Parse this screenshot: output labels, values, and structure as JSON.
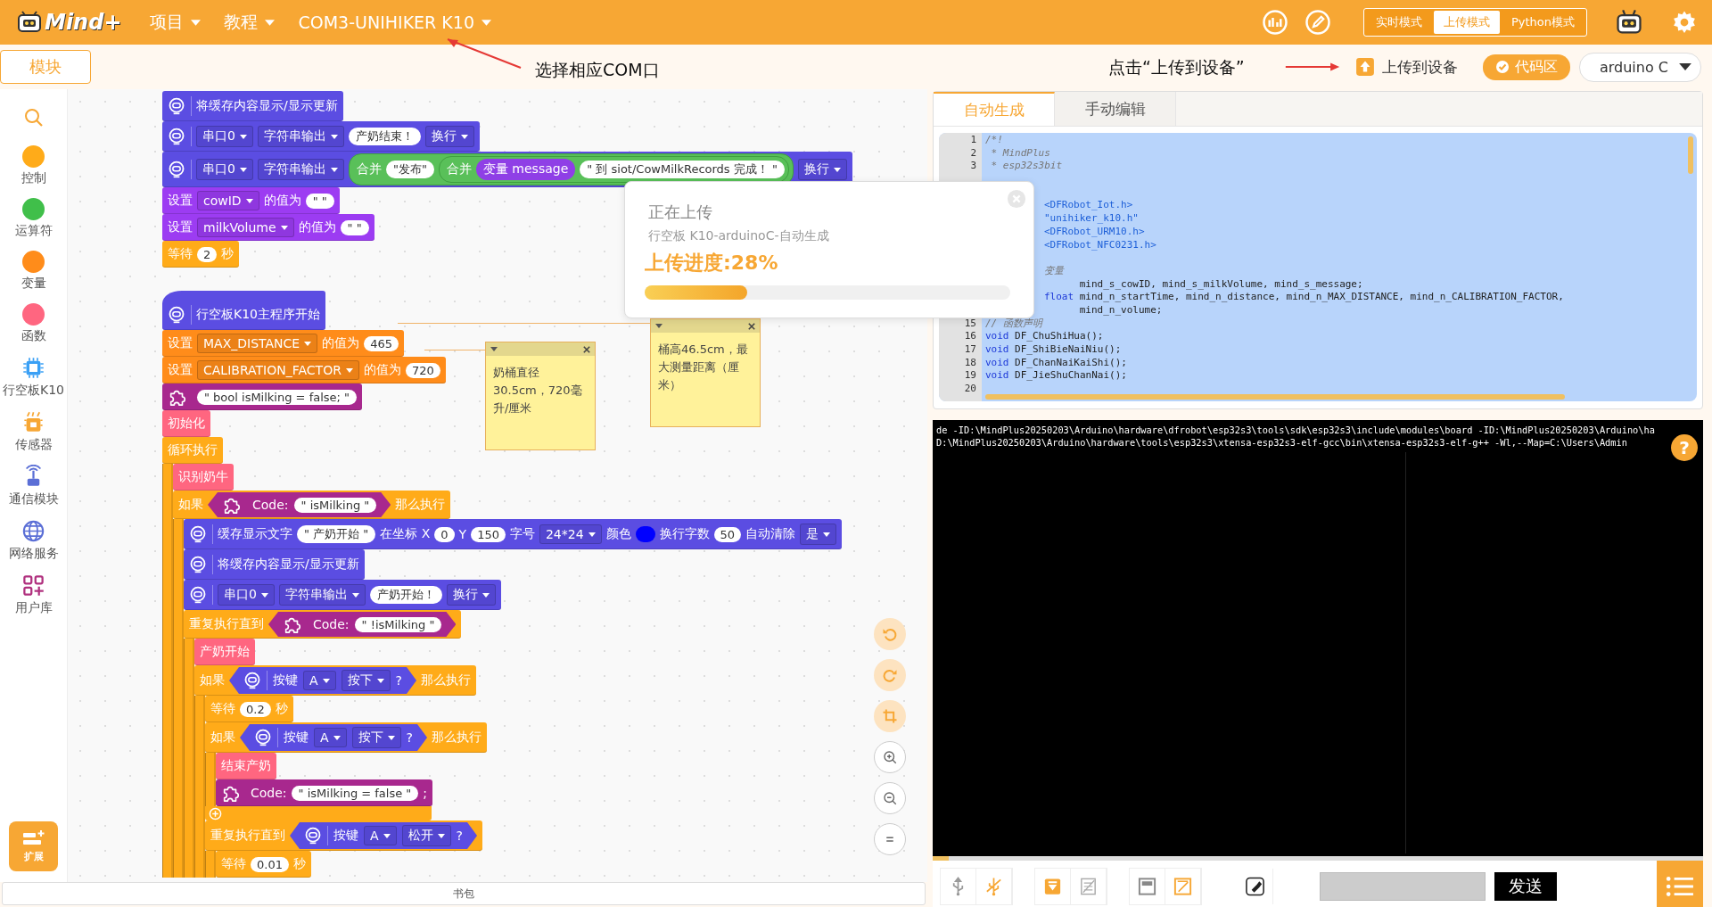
{
  "topbar": {
    "logo": "Mind+",
    "menus": [
      {
        "label": "项目"
      },
      {
        "label": "教程"
      },
      {
        "label": "COM3-UNIHIKER K10"
      }
    ],
    "modes": [
      {
        "label": "实时模式",
        "selected": false
      },
      {
        "label": "上传模式",
        "selected": true
      },
      {
        "label": "Python模式",
        "selected": false
      }
    ]
  },
  "toolbar": {
    "blocks_tab": "模块",
    "upload_button": "上传到设备",
    "code_toggle": {
      "label": "代码区",
      "on": true
    },
    "language": "arduino C"
  },
  "annotations": [
    {
      "text": "选择相应COM口"
    },
    {
      "text": "点击“上传到设备”"
    }
  ],
  "sidebar": {
    "categories": [
      {
        "label": "控制",
        "kind": "dot",
        "color": "#ffab19"
      },
      {
        "label": "运算符",
        "kind": "dot",
        "color": "#40bf4a"
      },
      {
        "label": "变量",
        "kind": "dot",
        "color": "#ff8c1a"
      },
      {
        "label": "函数",
        "kind": "dot",
        "color": "#ff6680"
      },
      {
        "label": "行空板K10",
        "kind": "board"
      },
      {
        "label": "传感器",
        "kind": "sensor"
      },
      {
        "label": "通信模块",
        "kind": "radio"
      },
      {
        "label": "网络服务",
        "kind": "globe"
      },
      {
        "label": "用户库",
        "kind": "library"
      }
    ],
    "extension_button": "扩展"
  },
  "scripts": [
    {
      "blocks": [
        {
          "kind": "board",
          "parts": [
            {
              "kind": "board_icon"
            },
            {
              "kind": "label",
              "text": "将缓存内容显示/显示更新"
            }
          ]
        },
        {
          "kind": "board",
          "parts": [
            {
              "kind": "board_icon"
            },
            {
              "kind": "menu",
              "text": "串口0"
            },
            {
              "kind": "menu",
              "text": "字符串输出"
            },
            {
              "kind": "string",
              "text": "产奶结束！"
            },
            {
              "kind": "menu",
              "text": "换行"
            }
          ]
        },
        {
          "kind": "board",
          "parts": [
            {
              "kind": "board_icon"
            },
            {
              "kind": "menu",
              "text": "串口0"
            },
            {
              "kind": "menu",
              "text": "字符串输出"
            },
            {
              "kind": "join",
              "parts": [
                {
                  "kind": "label",
                  "text": "合并"
                },
                {
                  "kind": "string",
                  "text": "\"发布\""
                },
                {
                  "kind": "join",
                  "parts": [
                    {
                      "kind": "label",
                      "text": "合并"
                    },
                    {
                      "kind": "variable",
                      "text": "变量 message"
                    },
                    {
                      "kind": "string",
                      "text": "\" 到 siot/CowMilkRecords 完成！ \""
                    }
                  ]
                }
              ]
            },
            {
              "kind": "menu",
              "text": "换行"
            }
          ]
        },
        {
          "kind": "data",
          "parts": [
            {
              "kind": "label",
              "text": "设置"
            },
            {
              "kind": "menu",
              "text": "cowID"
            },
            {
              "kind": "label",
              "text": "的值为"
            },
            {
              "kind": "string",
              "text": "\" \""
            }
          ]
        },
        {
          "kind": "data",
          "parts": [
            {
              "kind": "label",
              "text": "设置"
            },
            {
              "kind": "menu",
              "text": "milkVolume"
            },
            {
              "kind": "label",
              "text": "的值为"
            },
            {
              "kind": "string",
              "text": "\" \""
            }
          ]
        },
        {
          "kind": "control",
          "parts": [
            {
              "kind": "label",
              "text": "等待"
            },
            {
              "kind": "number",
              "text": "2"
            },
            {
              "kind": "label",
              "text": "秒"
            }
          ]
        }
      ]
    },
    {
      "blocks": [
        {
          "kind": "event",
          "parts": [
            {
              "kind": "board_icon"
            },
            {
              "kind": "label",
              "text": "行空板K10主程序开始"
            }
          ]
        },
        {
          "kind": "variable",
          "parts": [
            {
              "kind": "label",
              "text": "设置"
            },
            {
              "kind": "menu",
              "text": "MAX_DISTANCE"
            },
            {
              "kind": "label",
              "text": "的值为"
            },
            {
              "kind": "number",
              "text": "465"
            }
          ]
        },
        {
          "kind": "variable",
          "parts": [
            {
              "kind": "label",
              "text": "设置"
            },
            {
              "kind": "menu",
              "text": "CALIBRATION_FACTOR"
            },
            {
              "kind": "label",
              "text": "的值为"
            },
            {
              "kind": "number",
              "text": "720"
            }
          ]
        },
        {
          "kind": "code",
          "parts": [
            {
              "kind": "code_icon"
            },
            {
              "kind": "string",
              "text": "\" bool isMilking = false; \""
            }
          ]
        },
        {
          "kind": "function",
          "parts": [
            {
              "kind": "label",
              "text": "初始化"
            }
          ]
        },
        {
          "kind": "control",
          "parts": [
            {
              "kind": "label",
              "text": "循环执行"
            }
          ],
          "children": [
            {
              "kind": "function",
              "parts": [
                {
                  "kind": "label",
                  "text": "识别奶牛"
                }
              ]
            },
            {
              "kind": "control",
              "parts": [
                {
                  "kind": "label",
                  "text": "如果"
                },
                {
                  "kind": "code_condition",
                  "parts": [
                    {
                      "kind": "code_icon"
                    },
                    {
                      "kind": "label",
                      "text": "Code:"
                    },
                    {
                      "kind": "string",
                      "text": "\" isMilking \""
                    }
                  ]
                },
                {
                  "kind": "label",
                  "text": "那么执行"
                }
              ],
              "children": [
                {
                  "kind": "board",
                  "parts": [
                    {
                      "kind": "board_icon"
                    },
                    {
                      "kind": "label",
                      "text": "缓存显示文字"
                    },
                    {
                      "kind": "string",
                      "text": "\" 产奶开始 \""
                    },
                    {
                      "kind": "label",
                      "text": "在坐标 X"
                    },
                    {
                      "kind": "number",
                      "text": "0"
                    },
                    {
                      "kind": "label",
                      "text": "Y"
                    },
                    {
                      "kind": "number",
                      "text": "150"
                    },
                    {
                      "kind": "label",
                      "text": "字号"
                    },
                    {
                      "kind": "menu",
                      "text": "24*24"
                    },
                    {
                      "kind": "label",
                      "text": "颜色"
                    },
                    {
                      "kind": "color",
                      "color": "#0000ff"
                    },
                    {
                      "kind": "label",
                      "text": "换行字数"
                    },
                    {
                      "kind": "number",
                      "text": "50"
                    },
                    {
                      "kind": "label",
                      "text": "自动清除"
                    },
                    {
                      "kind": "menu",
                      "text": "是"
                    }
                  ]
                },
                {
                  "kind": "board",
                  "parts": [
                    {
                      "kind": "board_icon"
                    },
                    {
                      "kind": "label",
                      "text": "将缓存内容显示/显示更新"
                    }
                  ]
                },
                {
                  "kind": "board",
                  "parts": [
                    {
                      "kind": "board_icon"
                    },
                    {
                      "kind": "menu",
                      "text": "串口0"
                    },
                    {
                      "kind": "menu",
                      "text": "字符串输出"
                    },
                    {
                      "kind": "string",
                      "text": "产奶开始！"
                    },
                    {
                      "kind": "menu",
                      "text": "换行"
                    }
                  ]
                },
                {
                  "kind": "control",
                  "parts": [
                    {
                      "kind": "label",
                      "text": "重复执行直到"
                    },
                    {
                      "kind": "code_condition",
                      "parts": [
                        {
                          "kind": "code_icon"
                        },
                        {
                          "kind": "label",
                          "text": "Code:"
                        },
                        {
                          "kind": "string",
                          "text": "\" !isMilking \""
                        }
                      ]
                    }
                  ],
                  "children": [
                    {
                      "kind": "function",
                      "parts": [
                        {
                          "kind": "label",
                          "text": "产奶开始"
                        }
                      ]
                    },
                    {
                      "kind": "control",
                      "parts": [
                        {
                          "kind": "label",
                          "text": "如果"
                        },
                        {
                          "kind": "board_condition",
                          "parts": [
                            {
                              "kind": "board_icon"
                            },
                            {
                              "kind": "label",
                              "text": "按键"
                            },
                            {
                              "kind": "menu",
                              "text": "A"
                            },
                            {
                              "kind": "menu",
                              "text": "按下"
                            },
                            {
                              "kind": "label",
                              "text": "?"
                            }
                          ]
                        },
                        {
                          "kind": "label",
                          "text": "那么执行"
                        }
                      ],
                      "children": [
                        {
                          "kind": "control",
                          "parts": [
                            {
                              "kind": "label",
                              "text": "等待"
                            },
                            {
                              "kind": "number",
                              "text": "0.2"
                            },
                            {
                              "kind": "label",
                              "text": "秒"
                            }
                          ]
                        },
                        {
                          "kind": "control",
                          "closed": true,
                          "add_button": true,
                          "parts": [
                            {
                              "kind": "label",
                              "text": "如果"
                            },
                            {
                              "kind": "board_condition",
                              "parts": [
                                {
                                  "kind": "board_icon"
                                },
                                {
                                  "kind": "label",
                                  "text": "按键"
                                },
                                {
                                  "kind": "menu",
                                  "text": "A"
                                },
                                {
                                  "kind": "menu",
                                  "text": "按下"
                                },
                                {
                                  "kind": "label",
                                  "text": "?"
                                }
                              ]
                            },
                            {
                              "kind": "label",
                              "text": "那么执行"
                            }
                          ],
                          "children": [
                            {
                              "kind": "function",
                              "parts": [
                                {
                                  "kind": "label",
                                  "text": "结束产奶"
                                }
                              ]
                            },
                            {
                              "kind": "code",
                              "parts": [
                                {
                                  "kind": "code_icon"
                                },
                                {
                                  "kind": "label",
                                  "text": "Code:"
                                },
                                {
                                  "kind": "string",
                                  "text": "\" isMilking = false \""
                                },
                                {
                                  "kind": "label",
                                  "text": ";"
                                }
                              ]
                            }
                          ]
                        },
                        {
                          "kind": "control",
                          "parts": [
                            {
                              "kind": "label",
                              "text": "重复执行直到"
                            },
                            {
                              "kind": "board_condition",
                              "parts": [
                                {
                                  "kind": "board_icon"
                                },
                                {
                                  "kind": "label",
                                  "text": "按键"
                                },
                                {
                                  "kind": "menu",
                                  "text": "A"
                                },
                                {
                                  "kind": "menu",
                                  "text": "松开"
                                },
                                {
                                  "kind": "label",
                                  "text": "?"
                                }
                              ]
                            }
                          ],
                          "children": [
                            {
                              "kind": "control",
                              "parts": [
                                {
                                  "kind": "label",
                                  "text": "等待"
                                },
                                {
                                  "kind": "number",
                                  "text": "0.01"
                                },
                                {
                                  "kind": "label",
                                  "text": "秒"
                                }
                              ]
                            }
                          ]
                        }
                      ]
                    }
                  ]
                }
              ]
            }
          ]
        }
      ]
    }
  ],
  "notes": [
    {
      "text": "奶桶直径30.5cm，720毫升/厘米"
    },
    {
      "text": "桶高46.5cm，最大测量距离（厘米）"
    }
  ],
  "upload_dialog": {
    "title": "正在上传",
    "subtitle": "行空板 K10-arduinoC-自动生成",
    "progress_text": "上传进度:28%",
    "level": 0.28
  },
  "backpack": "书包",
  "code_panel": {
    "tabs": [
      {
        "label": "自动生成",
        "selected": true
      },
      {
        "label": "手动编辑",
        "selected": false
      }
    ],
    "lines": [
      {
        "number": "1",
        "tokens": [
          {
            "kind": "comment",
            "text": "/*!"
          }
        ]
      },
      {
        "number": "2",
        "tokens": [
          {
            "kind": "comment",
            "text": " * MindPlus"
          }
        ]
      },
      {
        "number": "3",
        "tokens": [
          {
            "kind": "comment",
            "text": " * esp32s3bit"
          }
        ]
      },
      {
        "covered": true
      },
      {
        "covered": true
      },
      {
        "covered": true,
        "tokens": [
          {
            "kind": "include",
            "text": "<DFRobot_Iot.h>"
          }
        ]
      },
      {
        "covered": true,
        "tokens": [
          {
            "kind": "include",
            "text": "\"unihiker_k10.h\""
          }
        ]
      },
      {
        "covered": true,
        "tokens": [
          {
            "kind": "include",
            "text": "<DFRobot_URM10.h>"
          }
        ]
      },
      {
        "covered": true,
        "tokens": [
          {
            "kind": "include",
            "text": "<DFRobot_NFC0231.h>"
          }
        ]
      },
      {
        "covered": true
      },
      {
        "covered": true,
        "tokens": [
          {
            "kind": "comment",
            "text": "变量"
          }
        ]
      },
      {
        "covered": true,
        "tokens": [
          {
            "kind": "plain",
            "text": "      mind_s_cowID, mind_s_milkVolume, mind_s_message;"
          }
        ]
      },
      {
        "covered": true,
        "tokens": [
          {
            "kind": "keyword",
            "text": "float"
          },
          {
            "kind": "plain",
            "text": " mind_n_startTime, mind_n_distance, mind_n_MAX_DISTANCE, mind_n_CALIBRATION_FACTOR,"
          }
        ]
      },
      {
        "covered": true,
        "tokens": [
          {
            "kind": "plain",
            "text": "      mind_n_volume;"
          }
        ]
      },
      {
        "number": "15",
        "tokens": [
          {
            "kind": "comment",
            "text": "// 函数声明"
          }
        ]
      },
      {
        "number": "16",
        "tokens": [
          {
            "kind": "keyword",
            "text": "void"
          },
          {
            "kind": "plain",
            "text": " DF_ChuShiHua();"
          }
        ]
      },
      {
        "number": "17",
        "tokens": [
          {
            "kind": "keyword",
            "text": "void"
          },
          {
            "kind": "plain",
            "text": " DF_ShiBieNaiNiu();"
          }
        ]
      },
      {
        "number": "18",
        "tokens": [
          {
            "kind": "keyword",
            "text": "void"
          },
          {
            "kind": "plain",
            "text": " DF_ChanNaiKaiShi();"
          }
        ]
      },
      {
        "number": "19",
        "tokens": [
          {
            "kind": "keyword",
            "text": "void"
          },
          {
            "kind": "plain",
            "text": " DF_JieShuChanNai();"
          }
        ]
      },
      {
        "number": "20"
      }
    ]
  },
  "console": {
    "lines": [
      "de -ID:\\MindPlus20250203\\Arduino\\hardware\\dfrobot\\esp32s3\\tools\\sdk\\esp32s3\\include\\modules\\board -ID:\\MindPlus20250203\\Arduino\\ha",
      "D:\\MindPlus20250203\\Arduino\\hardware\\tools\\esp32s3\\xtensa-esp32s3-elf-gcc\\bin\\xtensa-esp32s3-elf-g++ -Wl,--Map=C:\\Users\\Admin"
    ],
    "help": "?"
  },
  "serial": {
    "send_button": "发送"
  }
}
